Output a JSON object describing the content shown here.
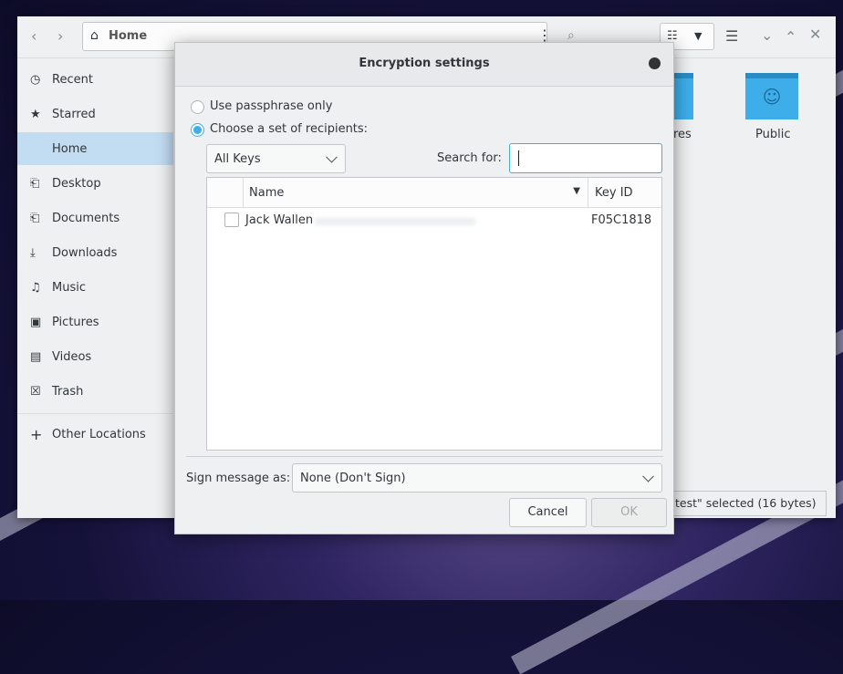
{
  "file_manager": {
    "location": "Home",
    "sidebar": [
      {
        "label": "Recent",
        "icon": "clock-icon"
      },
      {
        "label": "Starred",
        "icon": "star-icon"
      },
      {
        "label": "Home",
        "icon": "home-icon",
        "selected": true
      },
      {
        "label": "Desktop",
        "icon": "folder-icon"
      },
      {
        "label": "Documents",
        "icon": "folder-icon"
      },
      {
        "label": "Downloads",
        "icon": "download-icon"
      },
      {
        "label": "Music",
        "icon": "music-icon"
      },
      {
        "label": "Pictures",
        "icon": "picture-icon"
      },
      {
        "label": "Videos",
        "icon": "video-icon"
      },
      {
        "label": "Trash",
        "icon": "trash-icon"
      }
    ],
    "other_locations": "Other Locations",
    "folders": [
      {
        "label": "res"
      },
      {
        "label": "Public"
      }
    ],
    "status": "test\" selected  (16 bytes)",
    "accent": "#3daee9"
  },
  "dialog": {
    "title": "Encryption settings",
    "radio_passphrase": "Use passphrase only",
    "radio_recipients": "Choose a set of recipients:",
    "selected_radio": "recipients",
    "key_filter": "All Keys",
    "search_label": "Search for:",
    "search_value": "",
    "columns": {
      "name": "Name",
      "keyid": "Key ID"
    },
    "rows": [
      {
        "name": "Jack Wallen",
        "keyid": "F05C1818",
        "checked": false
      }
    ],
    "sign_label": "Sign message as:",
    "sign_value": "None (Don't Sign)",
    "cancel": "Cancel",
    "ok": "OK"
  }
}
